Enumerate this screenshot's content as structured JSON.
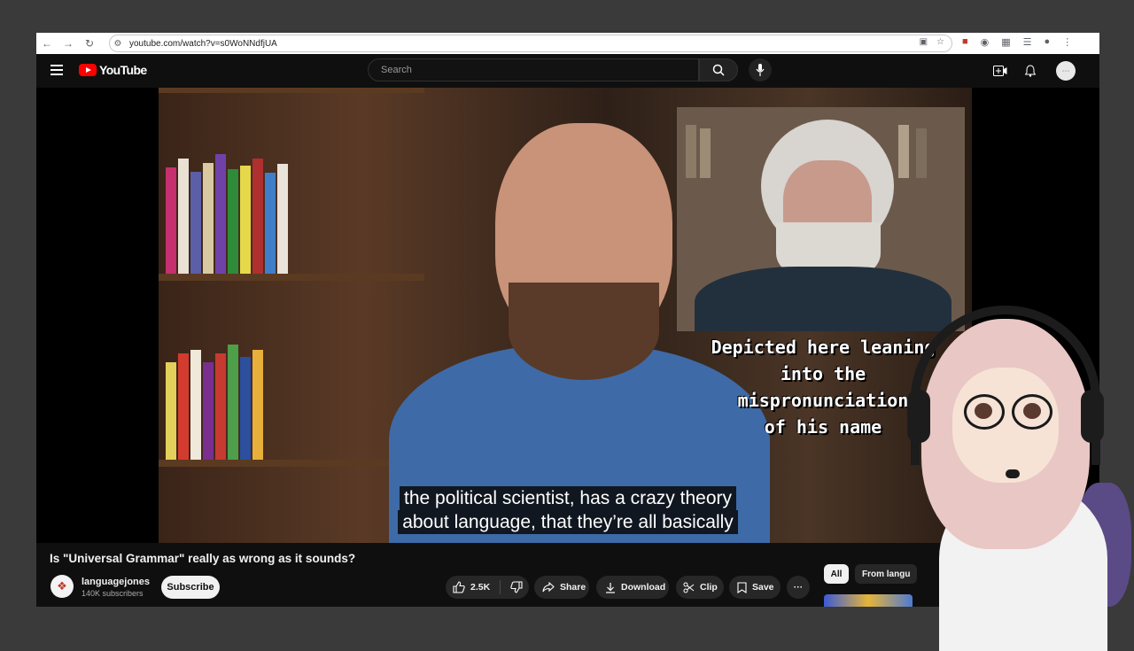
{
  "browser": {
    "url": "youtube.com/watch?v=s0WoNNdfjUA"
  },
  "header": {
    "logo_text": "YouTube",
    "search_placeholder": "Search"
  },
  "video": {
    "inset_caption_lines": [
      "Depicted here leaning",
      "into the",
      "mispronunciation",
      "of his name"
    ],
    "subtitle_lines": [
      "the political scientist, has a crazy theory",
      "about language, that they’re all basically"
    ]
  },
  "details": {
    "title": "Is \"Universal Grammar\" really as wrong as it sounds?",
    "channel_name": "languagejones",
    "channel_subscribers": "140K subscribers",
    "subscribe_label": "Subscribe",
    "like_count": "2.5K",
    "share_label": "Share",
    "download_label": "Download",
    "clip_label": "Clip",
    "save_label": "Save",
    "more_label": "···"
  },
  "sidebar": {
    "chips": [
      "All",
      "From langu"
    ]
  },
  "colors": {
    "brand_red": "#ff0000",
    "background": "#0f0f0f",
    "pill_bg": "#272727"
  }
}
